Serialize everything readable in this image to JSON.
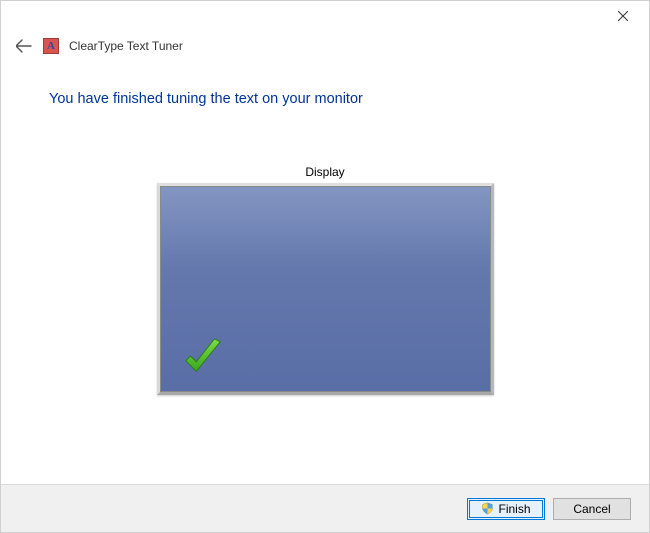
{
  "window": {
    "app_title": "ClearType Text Tuner",
    "app_icon_letter": "A"
  },
  "main": {
    "heading": "You have finished tuning the text on your monitor",
    "display_label": "Display"
  },
  "footer": {
    "finish_label": "Finish",
    "cancel_label": "Cancel"
  }
}
